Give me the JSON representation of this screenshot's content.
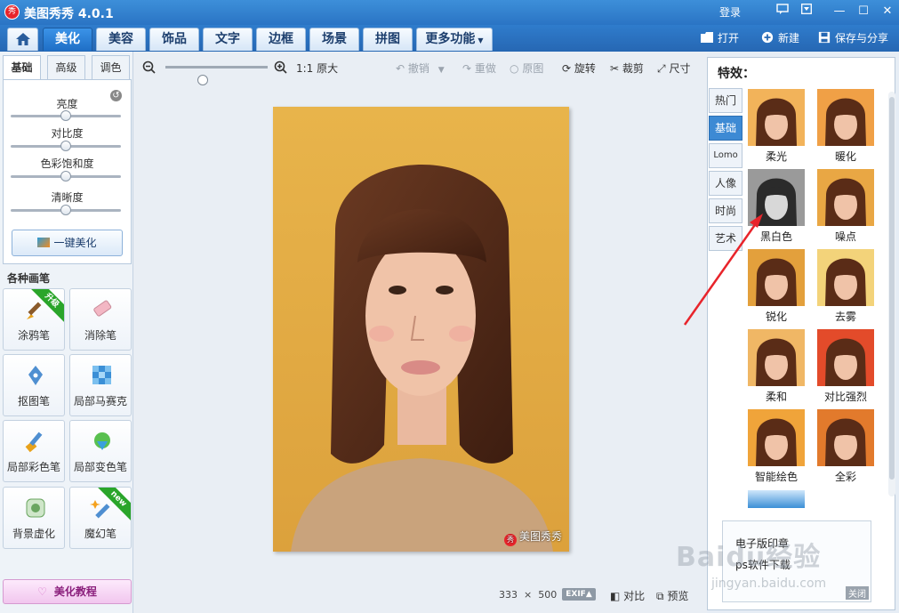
{
  "app": {
    "logo_text": "秀",
    "title": "美图秀秀 4.0.1",
    "login": "登录"
  },
  "window": {
    "minimize": "—",
    "maximize": "☐",
    "close": "✕"
  },
  "menu": {
    "tabs": [
      "美化",
      "美容",
      "饰品",
      "文字",
      "边框",
      "场景",
      "拼图",
      "更多功能"
    ],
    "active": "美化"
  },
  "actions": {
    "open": "打开",
    "new": "新建",
    "save_share": "保存与分享"
  },
  "adjust": {
    "tabs": [
      "基础",
      "高级",
      "调色"
    ],
    "active_tab": "基础",
    "sliders": [
      {
        "label": "亮度",
        "value": 0.5
      },
      {
        "label": "对比度",
        "value": 0.5
      },
      {
        "label": "色彩饱和度",
        "value": 0.5
      },
      {
        "label": "清晰度",
        "value": 0.5
      }
    ],
    "one_click": "一键美化"
  },
  "brushes": {
    "title": "各种画笔",
    "items": [
      {
        "label": "涂鸦笔",
        "badge": "升级"
      },
      {
        "label": "消除笔",
        "badge": ""
      },
      {
        "label": "抠图笔",
        "badge": ""
      },
      {
        "label": "局部马赛克",
        "badge": ""
      },
      {
        "label": "局部彩色笔",
        "badge": ""
      },
      {
        "label": "局部变色笔",
        "badge": ""
      },
      {
        "label": "背景虚化",
        "badge": ""
      },
      {
        "label": "魔幻笔",
        "badge": "new"
      }
    ],
    "tutorial": "美化教程"
  },
  "canvas_toolbar": {
    "actual_size": "1:1 原大",
    "undo": "撤销",
    "redo": "重做",
    "original": "原图",
    "rotate": "旋转",
    "crop": "裁剪",
    "resize": "尺寸",
    "zoom_level": 0.05
  },
  "photo": {
    "watermark": "美图秀秀",
    "width": "333",
    "height": "500"
  },
  "footer": {
    "times": "×",
    "exif": "EXIF▲",
    "compare": "对比",
    "preview": "预览"
  },
  "effects": {
    "title": "特效：",
    "categories": [
      "热门",
      "基础",
      "Lomo",
      "人像",
      "时尚",
      "艺术"
    ],
    "active_category": "基础",
    "items": [
      "柔光",
      "暖化",
      "黑白色",
      "噪点",
      "锐化",
      "去雾",
      "柔和",
      "对比强烈",
      "智能绘色",
      "全彩"
    ],
    "links": [
      "电子版印章",
      "ps软件下载"
    ],
    "close_ad": "关闭"
  },
  "watermark": {
    "site": "Baidu经验",
    "url": "jingyan.baidu.com"
  },
  "colors": {
    "accent": "#2a74c4",
    "arrow": "#e8242b"
  }
}
